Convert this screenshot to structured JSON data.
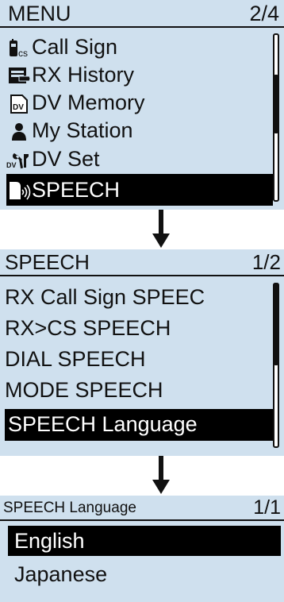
{
  "menu": {
    "title": "MENU",
    "page": "2/4",
    "items": [
      {
        "label": "Call Sign",
        "icon": "call-sign-icon"
      },
      {
        "label": "RX History",
        "icon": "rx-history-icon"
      },
      {
        "label": "DV Memory",
        "icon": "dv-memory-icon"
      },
      {
        "label": "My Station",
        "icon": "my-station-icon"
      },
      {
        "label": "DV Set",
        "icon": "dv-set-icon"
      },
      {
        "label": "SPEECH",
        "icon": "speaker-icon",
        "selected": true
      }
    ]
  },
  "speech": {
    "title": "SPEECH",
    "page": "1/2",
    "items": [
      {
        "label": "RX Call Sign SPEEC"
      },
      {
        "label": "RX>CS SPEECH"
      },
      {
        "label": "DIAL SPEECH"
      },
      {
        "label": "MODE SPEECH"
      },
      {
        "label": "SPEECH Language",
        "selected": true
      }
    ]
  },
  "language": {
    "title": "SPEECH Language",
    "page": "1/1",
    "items": [
      {
        "label": "English",
        "selected": true
      },
      {
        "label": "Japanese"
      }
    ]
  },
  "icon_text": {
    "cs": "cs",
    "dv": "DV"
  },
  "colors": {
    "screen_bg": "#cfe0ee",
    "text": "#111111",
    "selected_bg": "#000000",
    "selected_text": "#ffffff"
  }
}
